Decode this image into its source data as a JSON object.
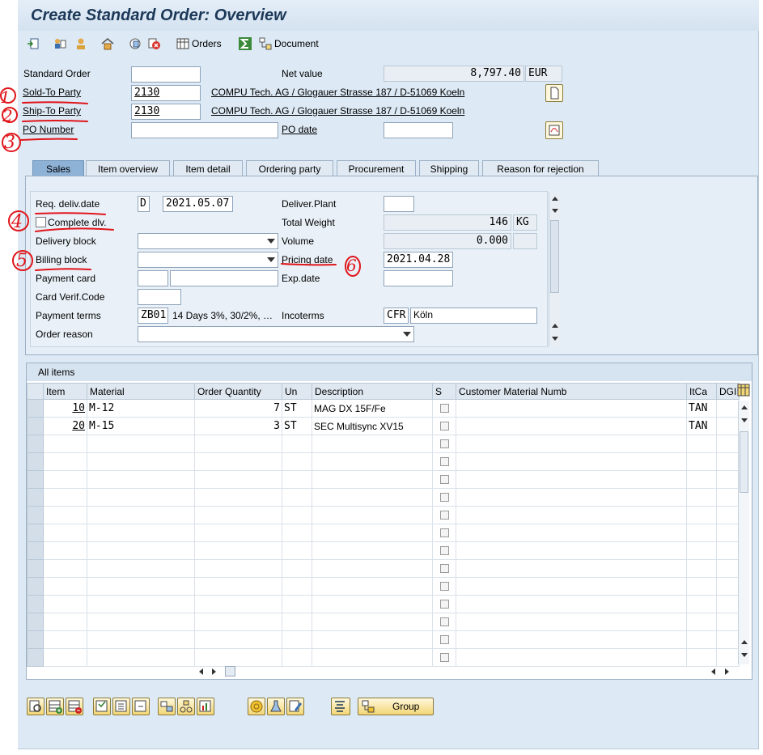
{
  "window": {
    "title": "Create Standard Order: Overview"
  },
  "toolbar": {
    "orders_label": "Orders",
    "document_label": "Document"
  },
  "header": {
    "standard_order_label": "Standard Order",
    "standard_order_value": "",
    "net_value_label": "Net value",
    "net_value": "8,797.40",
    "currency": "EUR",
    "sold_to_label": "Sold-To Party",
    "sold_to_value": "2130",
    "sold_to_address": "COMPU Tech. AG / Glogauer Strasse 187 / D-51069 Koeln",
    "ship_to_label": "Ship-To Party",
    "ship_to_value": "2130",
    "ship_to_address": "COMPU Tech. AG / Glogauer Strasse 187 / D-51069 Koeln",
    "po_number_label": "PO Number",
    "po_number_value": "",
    "po_date_label": "PO date",
    "po_date_value": ""
  },
  "tabs": [
    "Sales",
    "Item overview",
    "Item detail",
    "Ordering party",
    "Procurement",
    "Shipping",
    "Reason for rejection"
  ],
  "sales": {
    "req_deliv_label": "Req. deliv.date",
    "req_deliv_unit": "D",
    "req_deliv_value": "2021.05.07",
    "deliver_plant_label": "Deliver.Plant",
    "deliver_plant_value": "",
    "complete_dlv_label": "Complete dlv.",
    "total_weight_label": "Total Weight",
    "total_weight_value": "146",
    "total_weight_unit": "KG",
    "delivery_block_label": "Delivery block",
    "delivery_block_value": "",
    "volume_label": "Volume",
    "volume_value": "0.000",
    "volume_unit": "",
    "billing_block_label": "Billing block",
    "billing_block_value": "",
    "pricing_date_label": "Pricing date",
    "pricing_date_value": "2021.04.28",
    "payment_card_label": "Payment card",
    "exp_date_label": "Exp.date",
    "card_verif_label": "Card Verif.Code",
    "payment_terms_label": "Payment terms",
    "payment_terms_code": "ZB01",
    "payment_terms_text": "14 Days 3%, 30/2%, …",
    "incoterms_label": "Incoterms",
    "incoterms_code": "CFR",
    "incoterms_place": "Köln",
    "order_reason_label": "Order reason",
    "order_reason_value": ""
  },
  "items": {
    "title": "All items",
    "columns": [
      "Item",
      "Material",
      "Order Quantity",
      "Un",
      "Description",
      "S",
      "Customer Material Numb",
      "ItCa",
      "DGI"
    ],
    "rows": [
      {
        "item": "10",
        "material": "M-12",
        "qty": "7",
        "un": "ST",
        "desc": "MAG DX 15F/Fe",
        "cust": "",
        "itca": "TAN"
      },
      {
        "item": "20",
        "material": "M-15",
        "qty": "3",
        "un": "ST",
        "desc": "SEC Multisync XV15",
        "cust": "",
        "itca": "TAN"
      }
    ]
  },
  "bottom": {
    "group_label": "Group"
  },
  "annotations": [
    "1",
    "2",
    "3",
    "4",
    "5",
    "6"
  ],
  "colors": {
    "annotation": "#e0161b",
    "title": "#1c3857",
    "active_tab": "#8eb1d6"
  }
}
